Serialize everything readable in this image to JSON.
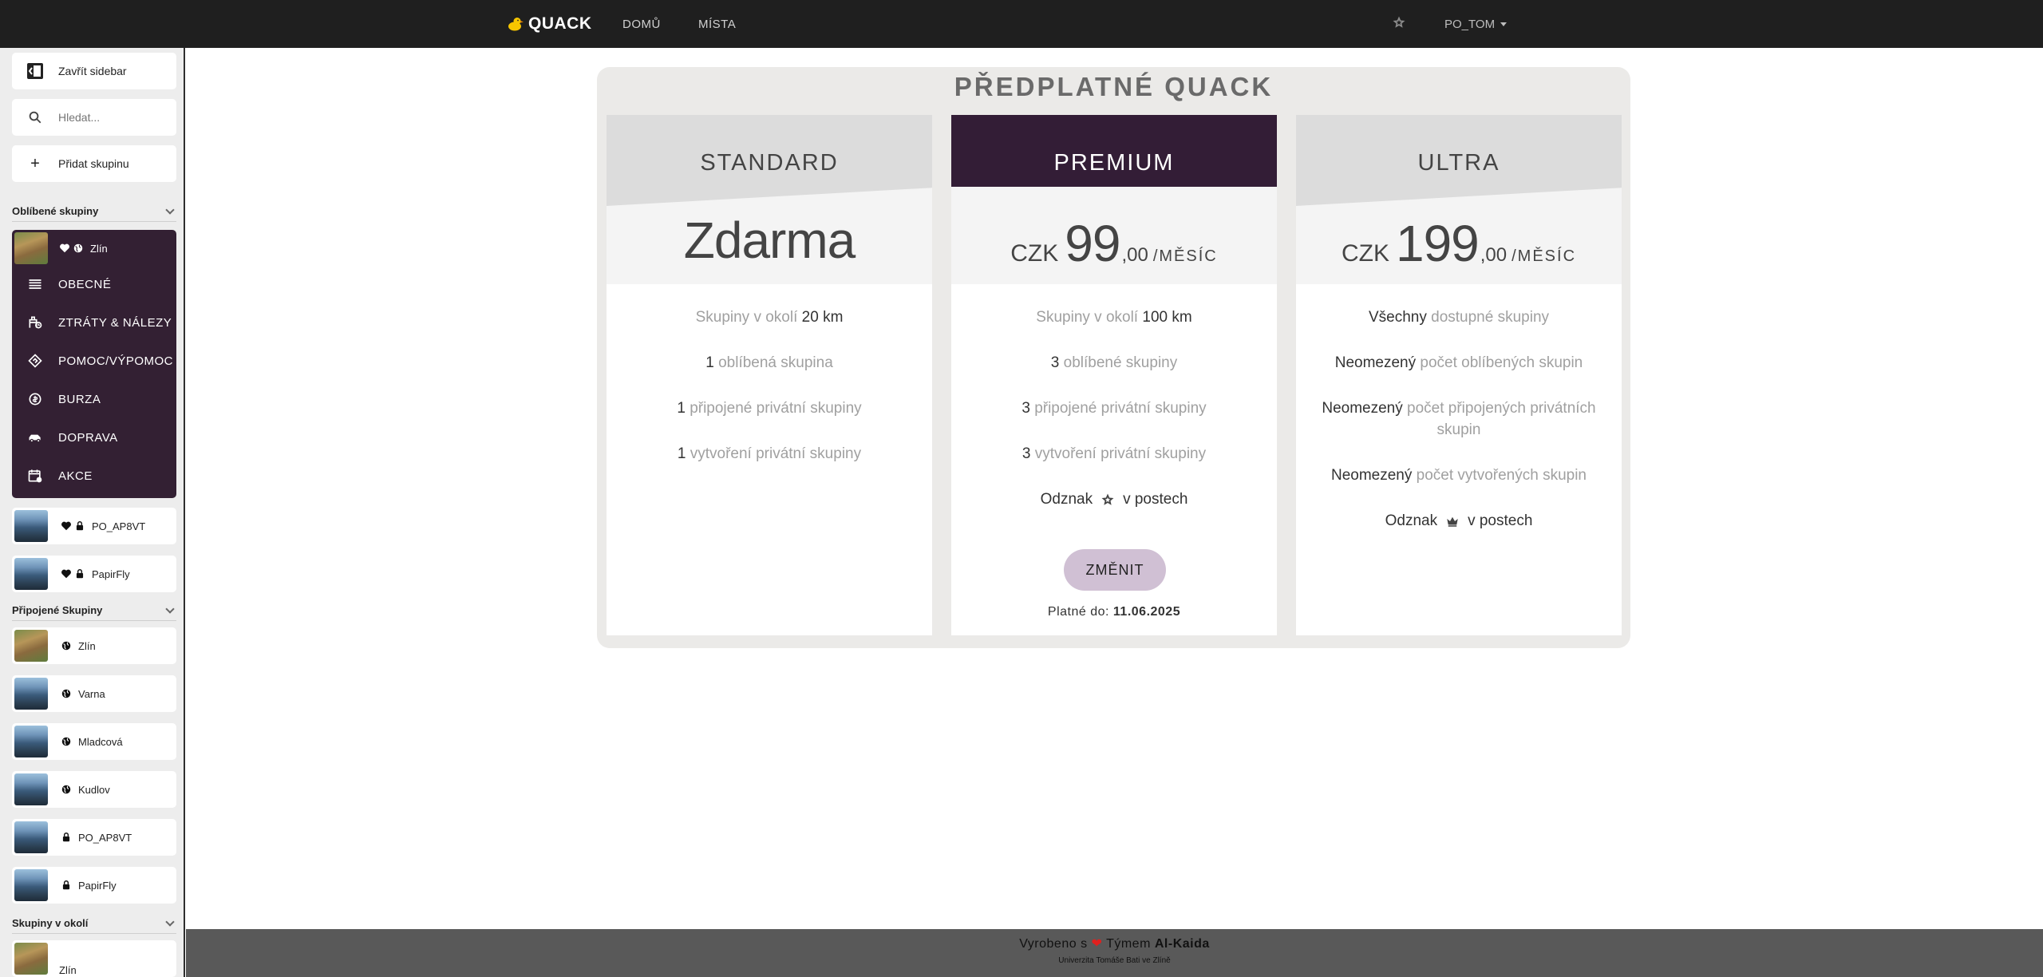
{
  "navbar": {
    "brand": "QUACK",
    "links": [
      "DOMŮ",
      "MÍSTA"
    ],
    "user": "PO_TOM"
  },
  "sidebar": {
    "close_label": "Zavřít sidebar",
    "search_placeholder": "Hledat...",
    "add_group_label": "Přidat skupinu",
    "sections": {
      "favorites": "Oblíbené skupiny",
      "joined": "Připojené Skupiny",
      "nearby": "Skupiny v okolí"
    },
    "active_favorite": {
      "name": "Zlín",
      "categories": [
        "OBECNÉ",
        "ZTRÁTY & NÁLEZY",
        "POMOC/VÝPOMOC",
        "BURZA",
        "DOPRAVA",
        "AKCE"
      ]
    },
    "favorites": [
      {
        "name": "PO_AP8VT"
      },
      {
        "name": "PapirFly"
      }
    ],
    "joined": [
      {
        "name": "Zlín"
      },
      {
        "name": "Varna"
      },
      {
        "name": "Mladcová"
      },
      {
        "name": "Kudlov"
      },
      {
        "name": "PO_AP8VT"
      },
      {
        "name": "PapirFly"
      }
    ],
    "nearby": [
      {
        "name": "Zlín"
      }
    ]
  },
  "pricing": {
    "title": "PŘEDPLATNÉ QUACK",
    "plans": [
      {
        "name": "STANDARD",
        "price_text": "Zdarma",
        "features": [
          {
            "a": "Skupiny v okolí",
            "b": "20 km"
          },
          {
            "a": "1",
            "b": "oblíbená skupina"
          },
          {
            "a": "1",
            "b": "připojené privátní skupiny"
          },
          {
            "a": "1",
            "b": "vytvoření privátní skupiny"
          }
        ]
      },
      {
        "name": "PREMIUM",
        "currency": "CZK",
        "amount": "99",
        "cents": ",00",
        "period": "/MĚSÍC",
        "features": [
          {
            "a": "Skupiny v okolí",
            "b": "100 km"
          },
          {
            "a": "3",
            "b": "oblíbené skupiny"
          },
          {
            "a": "3",
            "b": "připojené privátní skupiny"
          },
          {
            "a": "3",
            "b": "vytvoření privátní skupiny"
          }
        ],
        "badge_prefix": "Odznak",
        "badge_suffix": "v postech",
        "button_label": "ZMĚNIT",
        "valid_label": "Platné do:",
        "valid_date": "11.06.2025"
      },
      {
        "name": "ULTRA",
        "currency": "CZK",
        "amount": "199",
        "cents": ",00",
        "period": "/MĚSÍC",
        "features": [
          {
            "a": "Všechny",
            "b": "dostupné skupiny"
          },
          {
            "a": "Neomezený",
            "b": "počet oblíbených skupin"
          },
          {
            "a": "Neomezený",
            "b": "počet připojených privátních skupin"
          },
          {
            "a": "Neomezený",
            "b": "počet vytvořených skupin"
          }
        ],
        "badge_prefix": "Odznak",
        "badge_suffix": "v postech"
      }
    ]
  },
  "footer": {
    "made_prefix": "Vyrobeno s",
    "team_prefix": "Týmem",
    "team_name": "Al-Kaida",
    "university": "Univerzita Tomáše Bati ve Zlíně"
  },
  "colors": {
    "navbar": "#1f1f1f",
    "accent_dark": "#331d36",
    "button": "#d0c0d4",
    "footer": "#595959"
  }
}
